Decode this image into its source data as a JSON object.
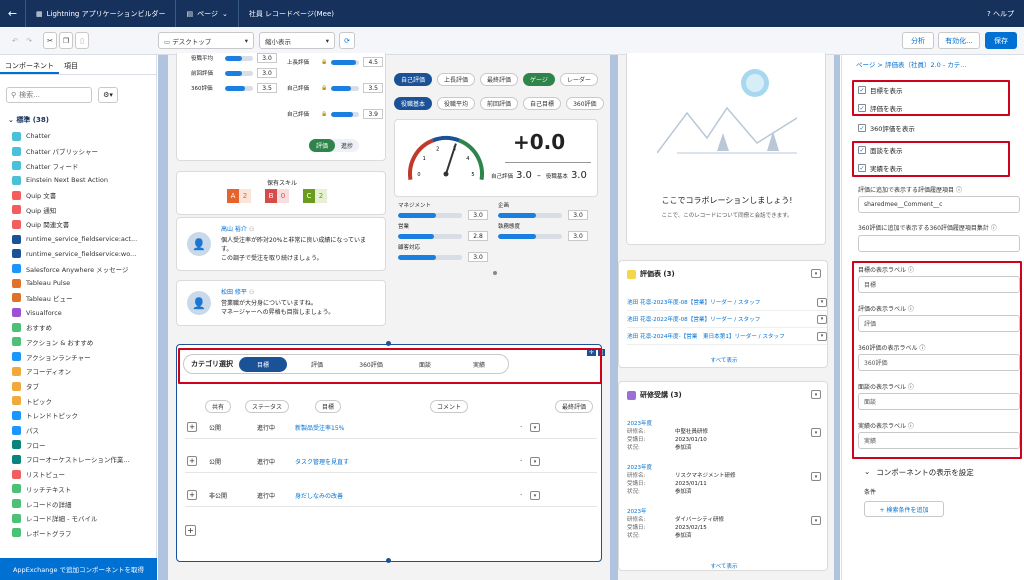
{
  "topbar": {
    "back": "←",
    "app_title": "Lightning アプリケーションビルダー",
    "pages_menu": "ページ",
    "page_name": "社員 レコードページ(Mee)",
    "help": "ヘルプ"
  },
  "toolbar": {
    "device": "デスクトップ",
    "zoom": "縮小表示",
    "analyze": "分析",
    "activate": "有効化...",
    "save": "保存"
  },
  "left": {
    "tabs": [
      "コンポーネント",
      "項目"
    ],
    "search_placeholder": "検索...",
    "section": "標準 (38)",
    "items": [
      {
        "label": "Chatter",
        "color": "#4bc0d9"
      },
      {
        "label": "Chatter パブリッシャー",
        "color": "#4bc0d9"
      },
      {
        "label": "Chatter フィード",
        "color": "#4bc0d9"
      },
      {
        "label": "Einstein Next Best Action",
        "color": "#4bc0d9"
      },
      {
        "label": "Quip 文書",
        "color": "#f25d5d"
      },
      {
        "label": "Quip 通知",
        "color": "#f25d5d"
      },
      {
        "label": "Quip 関連文書",
        "color": "#f25d5d"
      },
      {
        "label": "runtime_service_fieldservice:act...",
        "color": "#1b5297"
      },
      {
        "label": "runtime_service_fieldservice:wo...",
        "color": "#1b5297"
      },
      {
        "label": "Salesforce Anywhere メッセージ",
        "color": "#1b96ff"
      },
      {
        "label": "Tableau Pulse",
        "color": "#e0712b"
      },
      {
        "label": "Tableau ビュー",
        "color": "#e0712b"
      },
      {
        "label": "Visualforce",
        "color": "#9c4fd7"
      },
      {
        "label": "おすすめ",
        "color": "#4bc076"
      },
      {
        "label": "アクション & おすすめ",
        "color": "#4bc076"
      },
      {
        "label": "アクションランチャー",
        "color": "#1b96ff"
      },
      {
        "label": "アコーディオン",
        "color": "#f2a93b"
      },
      {
        "label": "タブ",
        "color": "#f2a93b"
      },
      {
        "label": "トピック",
        "color": "#f2a93b"
      },
      {
        "label": "トレンドトピック",
        "color": "#1b96ff"
      },
      {
        "label": "パス",
        "color": "#1b96ff"
      },
      {
        "label": "フロー",
        "color": "#0b827c"
      },
      {
        "label": "フローオーケストレーション作業...",
        "color": "#0b827c"
      },
      {
        "label": "リストビュー",
        "color": "#f25d5d"
      },
      {
        "label": "リッチテキスト",
        "color": "#4bc076"
      },
      {
        "label": "レコードの詳細",
        "color": "#4bc076"
      },
      {
        "label": "レコード詳細 - モバイル",
        "color": "#4bc076"
      },
      {
        "label": "レポートグラフ",
        "color": "#4bc076"
      }
    ],
    "appexchange": "AppExchange で追加コンポーネントを取得"
  },
  "canvas": {
    "eval_rows": [
      {
        "label": "役職平均",
        "value": "3.0",
        "fill": 0.6
      },
      {
        "label": "前回評価",
        "value": "3.0",
        "fill": 0.6
      },
      {
        "label": "360評価",
        "value": "3.5",
        "fill": 0.7
      }
    ],
    "eval_rows2": [
      {
        "label": "上長評価",
        "value": "4.5",
        "fill": 0.9
      },
      {
        "label": "自己評価",
        "value": "3.5",
        "fill": 0.7
      },
      {
        "label": "自己評価",
        "value": "3.9",
        "fill": 0.78
      }
    ],
    "toggle": [
      "評価",
      "進捗"
    ],
    "skill_title": "保有スキル",
    "skills": [
      {
        "grade": "A",
        "count": "2",
        "color": "#e8632b",
        "bg": "#fbe5d9"
      },
      {
        "grade": "B",
        "count": "0",
        "color": "#d84b4b",
        "bg": "#f8dede"
      },
      {
        "grade": "C",
        "count": "2",
        "color": "#6a9a1f",
        "bg": "#e6f0d4"
      }
    ],
    "comments": [
      {
        "name": "高山 裕介",
        "lines": [
          "個人受注率が昨対20%と非常に良い成績になっていま",
          "す。",
          "この調子で受注を取り続けましょう。"
        ]
      },
      {
        "name": "松田 修平",
        "lines": [
          "営業職が大分身についていますね。",
          "マネージャーへの昇格も目指しましょう。"
        ]
      }
    ],
    "tabs_row1": [
      "自己評価",
      "上長評価",
      "最終評価",
      "ゲージ",
      "レーダー"
    ],
    "tabs_row2": [
      "役職基本",
      "役職平均",
      "前回評価",
      "自己目標",
      "360評価"
    ],
    "gauge": {
      "value": "+0.0",
      "self_label": "自己評価",
      "self_value": "3.0",
      "base_label": "役職基本",
      "base_value": "3.0",
      "ticks": [
        "0",
        "1",
        "2",
        "3",
        "4",
        "5"
      ],
      "needle": 0.6
    },
    "skills_grid": [
      {
        "label": "マネジメント",
        "value": "3.0",
        "fill": 0.6
      },
      {
        "label": "企画",
        "value": "3.0",
        "fill": 0.6
      },
      {
        "label": "営業",
        "value": "2.8",
        "fill": 0.56
      },
      {
        "label": "執務態度",
        "value": "3.0",
        "fill": 0.6
      },
      {
        "label": "顧客対応",
        "value": "3.0",
        "fill": 0.6
      }
    ],
    "category": {
      "title": "カテゴリ選択",
      "tabs": [
        "目標",
        "評価",
        "360評価",
        "面談",
        "実績"
      ],
      "active": 0
    },
    "goal_table": {
      "headers": [
        "共有",
        "ステータス",
        "目標",
        "コメント",
        "最終評価"
      ],
      "rows": [
        {
          "share": "公開",
          "status": "進行中",
          "goal": "新製品受注率15%",
          "comment": "."
        },
        {
          "share": "公開",
          "status": "進行中",
          "goal": "タスク管理を見直す",
          "comment": "."
        },
        {
          "share": "非公開",
          "status": "進行中",
          "goal": "身だしなみの改善",
          "comment": "."
        }
      ]
    },
    "collab": {
      "title": "ここでコラボレーションしましょう!",
      "sub": "ここで、このレコードについて同僚と会話できます。"
    },
    "eval_list": {
      "title": "評価表 (3)",
      "items": [
        "池田 花凛-2023年度-08【営業】リーダー / スタッフ",
        "池田 花凛-2022年度-08【営業】リーダー / スタッフ",
        "池田 花凛-2024年度-【営業　東日本第1】リーダー / スタッフ"
      ],
      "view_all": "すべて表示"
    },
    "training": {
      "title": "研修受講 (3)",
      "items": [
        {
          "year": "2023年度",
          "name_label": "研修名:",
          "name": "中堅社員研修",
          "date_label": "受講日:",
          "date": "2023/01/10",
          "state_label": "状況:",
          "state": "参加済"
        },
        {
          "year": "2023年度",
          "name_label": "研修名:",
          "name": "リスクマネジメント研修",
          "date_label": "受講日:",
          "date": "2023/01/11",
          "state_label": "状況:",
          "state": "参加済"
        },
        {
          "year": "2023年",
          "name_label": "研修名:",
          "name": "ダイバーシティ研修",
          "date_label": "受講日:",
          "date": "2023/02/15",
          "state_label": "状況:",
          "state": "参加済"
        }
      ],
      "view_all": "すべて表示"
    }
  },
  "right": {
    "breadcrumb": "ページ > 評価表（社員）2.0 - カテ...",
    "checks": [
      {
        "label": "目標を表示",
        "checked": "✓"
      },
      {
        "label": "評価を表示",
        "checked": "✓"
      },
      {
        "label": "360評価を表示",
        "checked": "✓"
      },
      {
        "label": "面談を表示",
        "checked": "✓"
      },
      {
        "label": "実績を表示",
        "checked": "✓"
      }
    ],
    "field1_label": "評価に追加で表示する評価履歴項目",
    "field1_value": "sharedmee__Comment__c",
    "field2_label": "360評価に追加で表示する360評価履歴項目集計",
    "field2_value": "",
    "labels": [
      {
        "label": "目標の表示ラベル",
        "value": "目標"
      },
      {
        "label": "評価の表示ラベル",
        "value": "評価"
      },
      {
        "label": "360評価の表示ラベル",
        "value": "360評価"
      },
      {
        "label": "面談の表示ラベル",
        "value": "面談"
      },
      {
        "label": "実績の表示ラベル",
        "value": "実績"
      }
    ],
    "visibility": "コンポーネントの表示を設定",
    "condition": "条件",
    "add_filter": "+ 検索条件を追加"
  }
}
